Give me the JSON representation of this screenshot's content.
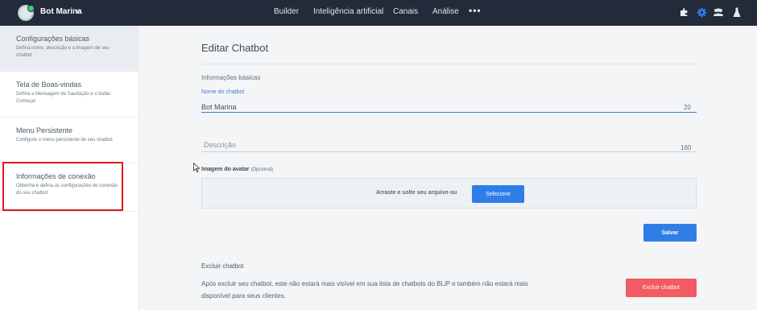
{
  "header": {
    "bot_name": "Bot Marina",
    "nav": [
      "Builder",
      "Inteligência artificial",
      "Canais",
      "Análise"
    ],
    "more": "•••",
    "icons": [
      "puzzle-icon",
      "gear-icon",
      "team-icon",
      "flask-icon"
    ],
    "colors": {
      "bar": "#232a39",
      "active_icon": "#2f7ee8"
    }
  },
  "sidebar": {
    "items": [
      {
        "title": "Configurações básicas",
        "desc": "Defina nome, descrição e a imagem de seu chatbot"
      },
      {
        "title": "Tela de Boas-vindas",
        "desc": "Defina a Mensagem de Saudação e o botão Começar"
      },
      {
        "title": "Menu Persistente",
        "desc": "Configure o menu persistente de seu chatbot"
      },
      {
        "title": "Informações de conexão",
        "desc": "Obtenha e defina as configurações de conexão do seu chatbot"
      }
    ]
  },
  "main": {
    "title": "Editar Chatbot",
    "section": "Informações básicas",
    "name_label": "Nome do chatbot",
    "name_value": "Bot Marina",
    "name_counter": "20",
    "desc_placeholder": "Descrição",
    "desc_counter": "160",
    "avatar_label": "Imagem do avatar",
    "avatar_optional": "(Opcional)",
    "drop_text": "Arraste e solte seu arquivo ou",
    "select_button": "Selecione",
    "save_button": "Salvar",
    "delete_title": "Excluir chatbot",
    "delete_desc": "Após excluir seu chatbot, este não estará mais visível em sua lista de chatbots do BLiP e também não estará mais disponível para seus clientes.",
    "delete_button": "Excluir chatbot"
  }
}
